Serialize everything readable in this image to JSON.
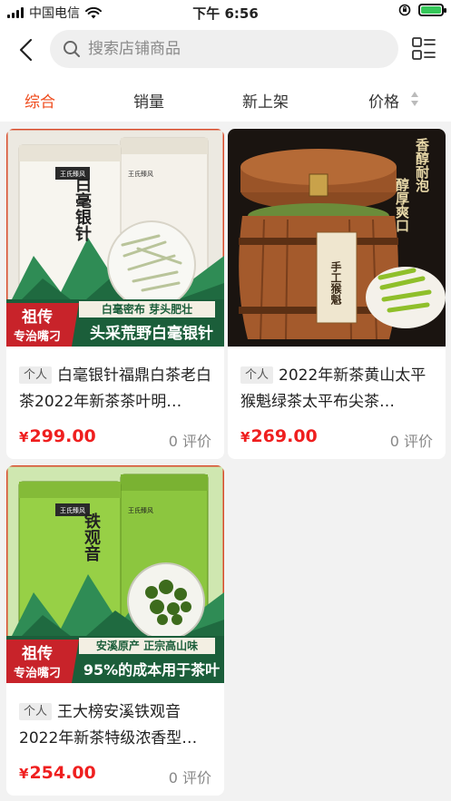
{
  "status_bar": {
    "carrier": "中国电信",
    "time": "下午 6:56"
  },
  "header": {
    "search_placeholder": "搜索店铺商品"
  },
  "sort_bar": {
    "items": [
      "综合",
      "销量",
      "新上架",
      "价格"
    ],
    "active": "综合"
  },
  "products": [
    {
      "tag": "个人",
      "title": "白毫银针福鼎白茶老白茶2022年新茶茶叶明…",
      "price": "299.00",
      "currency": "¥",
      "reviews": "0 评价",
      "image": {
        "brand": "王氏臻风",
        "can_label": "白毫银针",
        "banner_top": "白毫密布 芽头肥壮",
        "banner_main": "头采荒野白毫银针",
        "badge_top": "祖传",
        "badge_bottom": "专治嘴刁",
        "theme": "#d8d4c8"
      }
    },
    {
      "tag": "个人",
      "title": "2022年新茶黄山太平猴魁绿茶太平布尖茶…",
      "price": "269.00",
      "currency": "¥",
      "reviews": "0 评价",
      "image": {
        "slogan_right": "香醇耐泡",
        "slogan_left": "醇厚爽口",
        "barrel_label": "手工猴魁",
        "theme": "#1b1410"
      }
    },
    {
      "tag": "个人",
      "title": "王大榜安溪铁观音2022年新茶特级浓香型…",
      "price": "254.00",
      "currency": "¥",
      "reviews": "0 评价",
      "image": {
        "brand": "王氏臻风",
        "can_label": "铁观音",
        "banner_top": "安溪原产 正宗高山味",
        "banner_main": "95%的成本用于茶叶",
        "badge_top": "祖传",
        "badge_bottom": "专治嘴刁",
        "theme": "#8fc83a"
      }
    }
  ],
  "colors": {
    "accent": "#ef4b1c",
    "price": "#ef1f1f",
    "background": "#f2f2f2"
  }
}
